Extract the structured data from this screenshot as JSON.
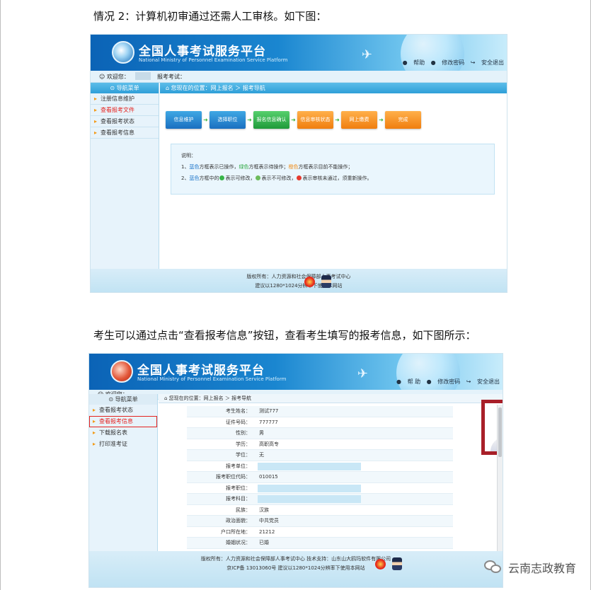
{
  "doc": {
    "para1": "情况 2：计算机初审通过还需人工审核。如下图：",
    "para2": "考生可以通过点击“查看报考信息”按钮，查看考生填写的报考信息，如下图所示："
  },
  "shot1": {
    "brand": "全国人事考试服务平台",
    "brand_sub": "National Ministry of Personnel Examination Service Platform",
    "links": [
      "帮助",
      "修改密码",
      "安全退出"
    ],
    "welcome": "欢迎您：",
    "exam_label": "报考考试：",
    "menu_title": "导航菜单",
    "menu": [
      "注册信息维护",
      "查看报考文件",
      "查看报考状态",
      "查看报考信息"
    ],
    "crumb": "您现在的位置：网上报名 ＞ 报考导航",
    "steps": [
      "信息维护",
      "选择职位",
      "报名信息确认",
      "信息审核状态",
      "网上缴费",
      "完成"
    ],
    "note": {
      "title": "说明：",
      "l1_pre": "1、",
      "l1_blue": "蓝色",
      "l1_a": "方框表示已操作，",
      "l1_green": "绿色",
      "l1_b": "方框表示待操作；",
      "l1_orange": "橙色",
      "l1_c": "方框表示目前不能操作；",
      "l2_pre": "2、",
      "l2_blue": "蓝色",
      "l2_a": "方框中的",
      "l2_b": "表示可修改，",
      "l2_c": "表示不可修改，",
      "l2_d": "表示审核未通过，须重新操作。"
    },
    "footer1": "版权所有：人力资源和社会保障部人事考试中心",
    "footer2": "建议以1280*1024分辨率下使用本网站"
  },
  "shot2": {
    "brand": "全国人事考试服务平台",
    "brand_sub": "National Ministry of Personnel Examination Service Platform",
    "links": [
      "帮 助",
      "修改密码",
      "安全退出"
    ],
    "welcome": "欢迎您：",
    "menu_title": "导航菜单",
    "menu": [
      "查看报考状态",
      "查看报考信息",
      "下载报名表",
      "打印准考证"
    ],
    "crumb": "您现在的位置：网上报名 ＞ 报考导航",
    "rows": [
      {
        "label": "考生姓名：",
        "value": "测试777"
      },
      {
        "label": "证件号码：",
        "value": "777777"
      },
      {
        "label": "性别：",
        "value": "男"
      },
      {
        "label": "学历：",
        "value": "高职高专"
      },
      {
        "label": "学位：",
        "value": "无"
      },
      {
        "label": "报考单位：",
        "value": ""
      },
      {
        "label": "报考职位代码：",
        "value": "010015"
      },
      {
        "label": "报考职位：",
        "value": ""
      },
      {
        "label": "报考科目：",
        "value": ""
      },
      {
        "label": "民族：",
        "value": "汉族"
      },
      {
        "label": "政治面貌：",
        "value": "中共党员"
      },
      {
        "label": "户口所在地：",
        "value": "21212"
      },
      {
        "label": "婚姻状况：",
        "value": "已婚"
      }
    ],
    "footer1": "版权所有：人力资源和社会保障部人事考试中心  技术支持：山东山大鸥玛软件有限公司",
    "footer2": "京ICP备 13013060号  建议以1280*1024分辨率下使用本网站"
  },
  "watermark": "云南志政教育"
}
